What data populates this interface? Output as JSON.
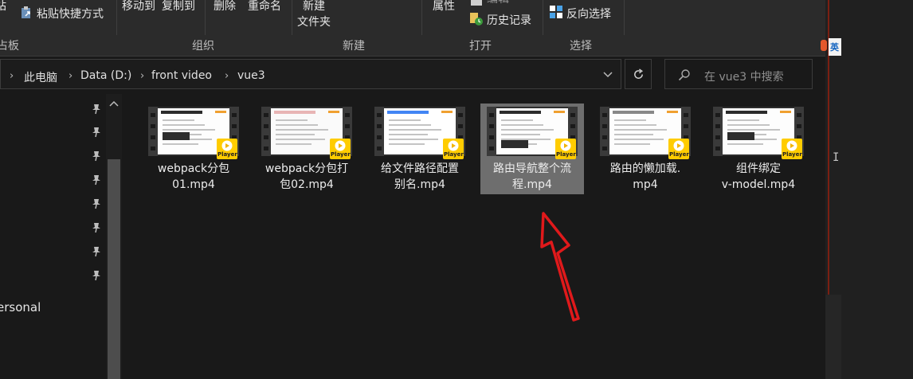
{
  "ribbon": {
    "clipboard": {
      "paste_partial": "站",
      "paste_shortcut": "粘贴快捷方式",
      "group_label": "占板"
    },
    "organize": {
      "move_to": "移动到",
      "copy_to": "复制到",
      "delete": "删除",
      "rename": "重命名",
      "group_label": "组织"
    },
    "new": {
      "new_folder_line1": "新建",
      "new_folder_line2": "文件夹",
      "group_label": "新建"
    },
    "open": {
      "properties": "属性",
      "edit": "编辑",
      "history": "历史记录",
      "group_label": "打开"
    },
    "select": {
      "invert": "反向选择",
      "group_label": "选择"
    }
  },
  "address": {
    "breadcrumbs": [
      "此电脑",
      "Data (D:)",
      "front video",
      "vue3"
    ]
  },
  "search": {
    "placeholder": "在 vue3 中搜索"
  },
  "sidebar": {
    "partial_label": "ersonal"
  },
  "files": [
    {
      "name": "webpack分包01.mp4",
      "line1": "webpack分包",
      "line2": "01.mp4",
      "selected": false,
      "badge": "Player"
    },
    {
      "name": "webpack分包打包02.mp4",
      "line1": "webpack分包打",
      "line2": "包02.mp4",
      "selected": false,
      "badge": "Player"
    },
    {
      "name": "给文件路径配置别名.mp4",
      "line1": "给文件路径配置",
      "line2": "别名.mp4",
      "selected": false,
      "badge": "Player"
    },
    {
      "name": "路由导航整个流程.mp4",
      "line1": "路由导航整个流",
      "line2": "程.mp4",
      "selected": true,
      "badge": "Player"
    },
    {
      "name": "路由的懒加载.mp4",
      "line1": "路由的懒加载.",
      "line2": "mp4",
      "selected": false,
      "badge": "Player"
    },
    {
      "name": "组件绑定v-model.mp4",
      "line1": "组件绑定",
      "line2": "v-model.mp4",
      "selected": false,
      "badge": "Player"
    }
  ],
  "side_app": {
    "lang_badge": "英"
  },
  "colors": {
    "accent_badge": "#ffcc00",
    "selection": "#6e6e6e",
    "annotation_arrow": "#e0191b"
  }
}
